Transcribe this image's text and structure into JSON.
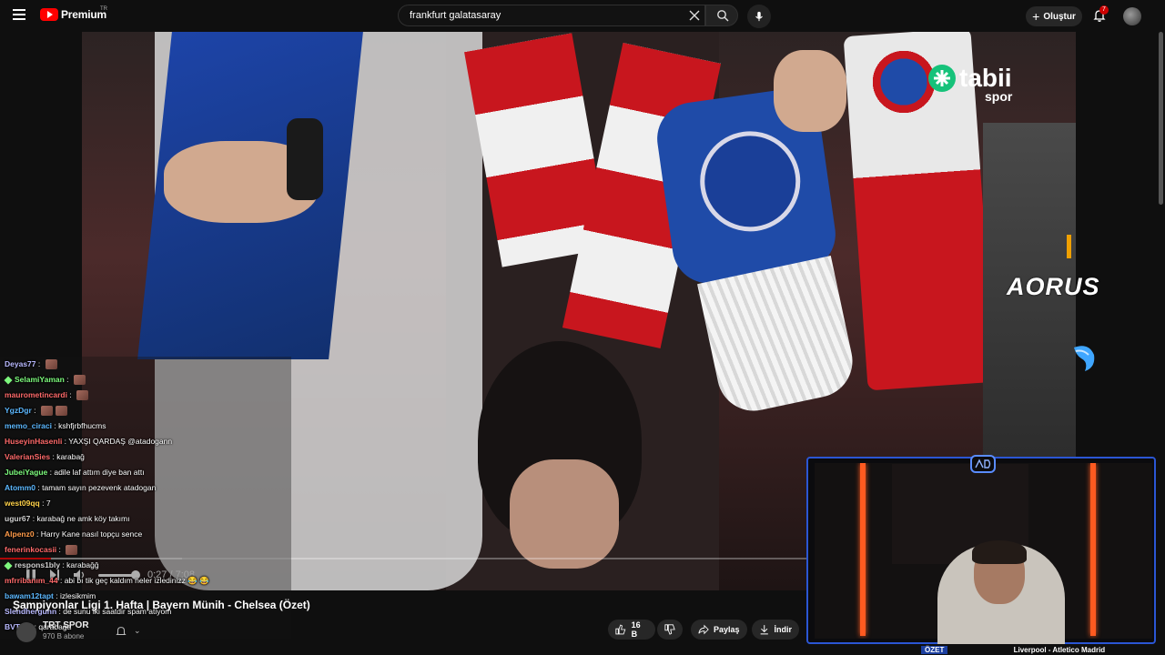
{
  "header": {
    "logo_text": "Premium",
    "logo_sup": "TR",
    "search_value": "frankfurt galatasaray",
    "create_label": "Oluştur",
    "notif_count": "7"
  },
  "video": {
    "watermark": "tabii",
    "watermark_sub": "spor",
    "sponsor": "AORUS",
    "time": "0:27 / 7:08",
    "progress": 0.063,
    "title": "Şampiyonlar Ligi 1. Hafta | Bayern Münih - Chelsea (Özet)"
  },
  "channel": {
    "name": "TRT SPOR",
    "subs": "970 B abone"
  },
  "actions": {
    "like_count": "16 B",
    "share_label": "Paylaş",
    "download_label": "İndir"
  },
  "ticker": {
    "tag": "ÖZET",
    "text": "Liverpool - Atletico Madrid"
  },
  "chat": [
    {
      "user": "Deyas77",
      "color": "#b9b9ff",
      "text": "",
      "emote": 1
    },
    {
      "user": "SelamiYaman",
      "color": "#7dfc7d",
      "text": "",
      "emote": 1,
      "gem": true
    },
    {
      "user": "maurometincardi",
      "color": "#ff6a6a",
      "text": "",
      "emote": 1
    },
    {
      "user": "YgzDgr",
      "color": "#5cb8ff",
      "text": "",
      "emote": 2
    },
    {
      "user": "memo_ciraci",
      "color": "#5cb8ff",
      "text": "kshfjrbfhucms"
    },
    {
      "user": "HuseyinHasenli",
      "color": "#ff6a6a",
      "text": "YAXŞI QARDAŞ @atadogann"
    },
    {
      "user": "ValerianSies",
      "color": "#ff6a6a",
      "text": "karabağ"
    },
    {
      "user": "JubeiYague",
      "color": "#7dfc7d",
      "text": "adile laf attım diye ban attı"
    },
    {
      "user": "Atomm0",
      "color": "#5cb8ff",
      "text": "tamam sayın pezevenk atadogan"
    },
    {
      "user": "west09qq",
      "color": "#ffd24a",
      "text": "7"
    },
    {
      "user": "ugur67",
      "color": "#d0d0d0",
      "text": "karabağ ne amk köy takımı"
    },
    {
      "user": "Alpenz0",
      "color": "#ff9b4a",
      "text": "Harry Kane nasıl topçu sence"
    },
    {
      "user": "fenerinkocasii",
      "color": "#ff6a6a",
      "text": "",
      "emote": 1
    },
    {
      "user": "respons1bly",
      "color": "#d0d0d0",
      "text": "karabağğ",
      "gem": true
    },
    {
      "user": "mfrribanım_44",
      "color": "#ff6a6a",
      "text": "abi bı tik geç kaldım neler izledinizz 😂 😂"
    },
    {
      "user": "bawam12tapt",
      "color": "#5cb8ff",
      "text": "izlesikmim"
    },
    {
      "user": "Slendhergunn",
      "color": "#b9b9ff",
      "text": "de sunu iki saatdir spam atiyom"
    },
    {
      "user": "BVTIKlI",
      "color": "#b9b9ff",
      "text": "qarabağa"
    }
  ]
}
